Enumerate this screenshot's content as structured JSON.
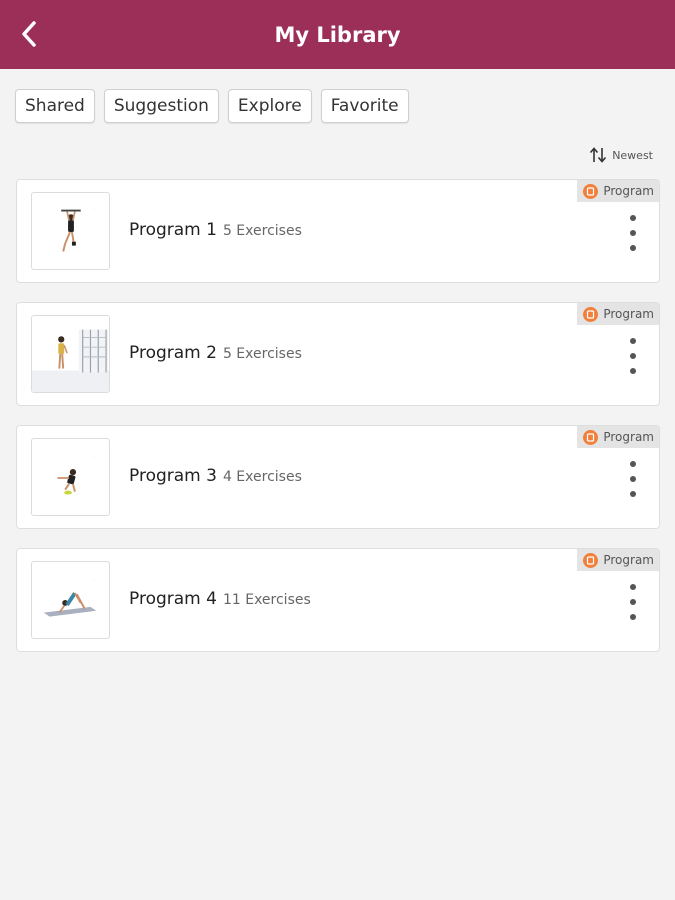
{
  "header": {
    "title": "My Library",
    "back_icon": "chevron-left-icon"
  },
  "filters": [
    {
      "label": "Shared"
    },
    {
      "label": "Suggestion"
    },
    {
      "label": "Explore"
    },
    {
      "label": "Favorite"
    }
  ],
  "sort": {
    "label": "Newest",
    "icon": "sort-arrows-icon"
  },
  "programs": [
    {
      "name": "Program 1",
      "count": "5 Exercises",
      "badge": "Program",
      "thumbnail": "hanging-exercise"
    },
    {
      "name": "Program 2",
      "count": "5 Exercises",
      "badge": "Program",
      "thumbnail": "standing-with-rack"
    },
    {
      "name": "Program 3",
      "count": "4 Exercises",
      "badge": "Program",
      "thumbnail": "squat-exercise"
    },
    {
      "name": "Program 4",
      "count": "11 Exercises",
      "badge": "Program",
      "thumbnail": "yoga-pose"
    }
  ],
  "colors": {
    "header": "#9b2f58",
    "badge_icon": "#f0803c",
    "background": "#f3f3f3"
  }
}
